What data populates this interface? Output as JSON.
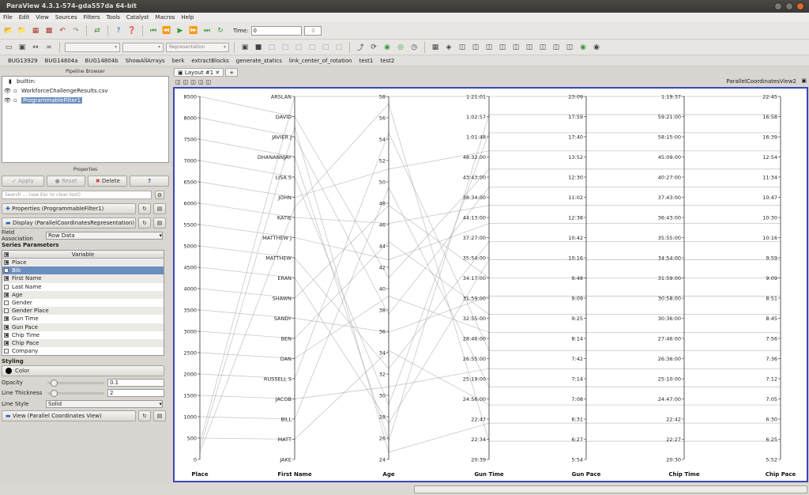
{
  "window": {
    "title": "ParaView 4.3.1-574-gda557da 64-bit"
  },
  "menu": [
    "File",
    "Edit",
    "View",
    "Sources",
    "Filters",
    "Tools",
    "Catalyst",
    "Macros",
    "Help"
  ],
  "toolbar": {
    "time_label": "Time:",
    "time_value": "0",
    "time_index": "0",
    "representation_placeholder": "Representation"
  },
  "macros": [
    "BUG13929",
    "BUG14804a",
    "BUG14804b",
    "ShowAllArrays",
    "berk",
    "extractBlocks",
    "generate_statics",
    "link_center_of_rotation",
    "test1",
    "test2"
  ],
  "pipeline": {
    "title": "Pipeline Browser",
    "items": [
      {
        "label": "builtin:",
        "eye": false,
        "selected": false
      },
      {
        "label": "WorkforceChallengeResults.csv",
        "eye": true,
        "selected": false
      },
      {
        "label": "ProgrammableFilter1",
        "eye": true,
        "selected": true
      }
    ]
  },
  "properties": {
    "title": "Properties",
    "apply": "Apply",
    "reset": "Reset",
    "delete": "Delete",
    "help": "?",
    "search_placeholder": "Search ... (use Esc to clear text)",
    "section_properties": "Properties (ProgrammableFilter1)",
    "section_display": "Display (ParallelCoordinatesRepresentation)",
    "field_association_label": "Field Association",
    "field_association_value": "Row Data",
    "series_parameters_label": "Series Parameters",
    "variable_header": "Variable",
    "variables": [
      {
        "name": "Place",
        "checked": true,
        "selected": false
      },
      {
        "name": "Bib",
        "checked": false,
        "selected": true
      },
      {
        "name": "First Name",
        "checked": true,
        "selected": false
      },
      {
        "name": "Last Name",
        "checked": false,
        "selected": false
      },
      {
        "name": "Age",
        "checked": true,
        "selected": false
      },
      {
        "name": "Gender",
        "checked": false,
        "selected": false
      },
      {
        "name": "Gender Place",
        "checked": false,
        "selected": false
      },
      {
        "name": "Gun Time",
        "checked": true,
        "selected": false
      },
      {
        "name": "Gun Pace",
        "checked": true,
        "selected": false
      },
      {
        "name": "Chip Time",
        "checked": true,
        "selected": false
      },
      {
        "name": "Chip Pace",
        "checked": true,
        "selected": false
      },
      {
        "name": "Company",
        "checked": false,
        "selected": false
      }
    ],
    "styling_label": "Styling",
    "color_button": "Color",
    "opacity_label": "Opacity",
    "opacity_value": "0.1",
    "line_thickness_label": "Line Thickness",
    "line_thickness_value": "2",
    "line_style_label": "Line Style",
    "line_style_value": "Solid",
    "section_view": "View (Parallel Coordinates View)"
  },
  "layout": {
    "tab_label": "Layout #1",
    "add_tab": "+",
    "view_name": "ParallelCoordinatesView2"
  },
  "chart_data": {
    "type": "parallel_coordinates",
    "axes": [
      {
        "name": "Place",
        "ticks": [
          "8500",
          "8000",
          "7500",
          "7000",
          "6500",
          "6000",
          "5500",
          "5000",
          "4500",
          "4000",
          "3500",
          "3000",
          "2500",
          "2000",
          "1500",
          "1000",
          "500",
          "0"
        ]
      },
      {
        "name": "First Name",
        "ticks": [
          "ARSLAN",
          "DAVID",
          "JAVIER J",
          "DHANANNJAY",
          "LISA S",
          "JOHN",
          "KATIE",
          "MATTHEW J",
          "MATTHEW",
          "ERAN",
          "SHAWN",
          "SANDY",
          "BEN",
          "DAN",
          "RUSSELL S",
          "JACOB",
          "BILL",
          "MATT",
          "JAKE"
        ]
      },
      {
        "name": "Age",
        "ticks": [
          "58",
          "56",
          "54",
          "52",
          "50",
          "48",
          "46",
          "44",
          "42",
          "40",
          "38",
          "36",
          "34",
          "32",
          "30",
          "28",
          "26",
          "24"
        ]
      },
      {
        "name": "Gun Time",
        "ticks": [
          "1:21:01",
          "1:02:57",
          "1:01:48",
          "48:32:00",
          "43:43:00",
          "38:34:00",
          "44:13:00",
          "37:27:00",
          "35:54:00",
          "34:17:00",
          "31:59:00",
          "32:55:00",
          "28:46:00",
          "26:55:00",
          "25:19:00",
          "24:56:00",
          "22:47",
          "22:34",
          "20:39"
        ]
      },
      {
        "name": "Gun Pace",
        "ticks": [
          "23:09",
          "17:59",
          "17:40",
          "13:52",
          "12:30",
          "11:02",
          "12:38",
          "10:42",
          "10:16",
          "9:48",
          "9:09",
          "9:25",
          "8:14",
          "7:42",
          "7:14",
          "7:08",
          "6:31",
          "6:27",
          "5:54"
        ]
      },
      {
        "name": "Chip Time",
        "ticks": [
          "1:19:37",
          "59:21:00",
          "58:15:00",
          "45:09:00",
          "40:27:00",
          "37:43:00",
          "36:43:00",
          "35:55:00",
          "34:54:00",
          "31:59:00",
          "30:58:00",
          "30:36:00",
          "27:46:00",
          "26:36:00",
          "25:10:00",
          "24:47:00",
          "22:42",
          "22:27",
          "20:30"
        ]
      },
      {
        "name": "Chip Pace",
        "ticks": [
          "22:45",
          "16:58",
          "16:39",
          "12:54",
          "11:34",
          "10:47",
          "10:30",
          "10:16",
          "9:59",
          "9:09",
          "8:51",
          "8:45",
          "7:56",
          "7:36",
          "7:12",
          "7:05",
          "6:30",
          "6:25",
          "5:52"
        ]
      }
    ],
    "records": [
      [
        0.9549,
        0.0,
        0.0,
        0.0,
        0.0,
        0.0,
        0.0
      ],
      [
        0.0,
        0.0556,
        0.5,
        0.2,
        0.2,
        0.2,
        0.2
      ],
      [
        0.0588,
        0.1111,
        0.6,
        0.25,
        0.25,
        0.25,
        0.25
      ],
      [
        0.1176,
        0.1667,
        0.95,
        0.05,
        0.05,
        0.05,
        0.05
      ],
      [
        0.1765,
        0.2222,
        0.85,
        0.1,
        0.1,
        0.1,
        0.1
      ],
      [
        0.2353,
        0.2778,
        0.2,
        0.15,
        0.15,
        0.15,
        0.15
      ],
      [
        0.2941,
        0.3333,
        0.35,
        0.3,
        0.3,
        0.3,
        0.3
      ],
      [
        0.3529,
        0.3889,
        0.45,
        0.35,
        0.35,
        0.35,
        0.35
      ],
      [
        0.4118,
        0.4444,
        0.75,
        0.4,
        0.4,
        0.4,
        0.4
      ],
      [
        0.4706,
        0.5,
        0.9,
        0.45,
        0.45,
        0.45,
        0.45
      ],
      [
        0.5294,
        0.5556,
        0.3,
        0.5,
        0.5,
        0.5,
        0.5
      ],
      [
        0.5882,
        0.6111,
        0.65,
        0.55,
        0.55,
        0.55,
        0.55
      ],
      [
        0.6471,
        0.6667,
        0.4,
        0.6,
        0.6,
        0.6,
        0.6
      ],
      [
        0.7059,
        0.7222,
        0.55,
        0.65,
        0.65,
        0.65,
        0.65
      ],
      [
        0.7647,
        0.7778,
        0.1,
        0.7,
        0.7,
        0.7,
        0.7
      ],
      [
        0.8235,
        0.8333,
        0.8,
        0.75,
        0.75,
        0.75,
        0.75
      ],
      [
        0.8824,
        0.8889,
        0.25,
        0.8,
        0.8,
        0.8,
        0.8
      ],
      [
        0.9412,
        0.9444,
        0.7,
        0.85,
        0.85,
        0.85,
        0.85
      ],
      [
        0.9706,
        0.0833,
        0.98,
        0.9,
        0.9,
        0.9,
        0.9
      ],
      [
        0.9804,
        0.3056,
        0.02,
        0.95,
        0.95,
        0.95,
        0.95
      ]
    ]
  }
}
